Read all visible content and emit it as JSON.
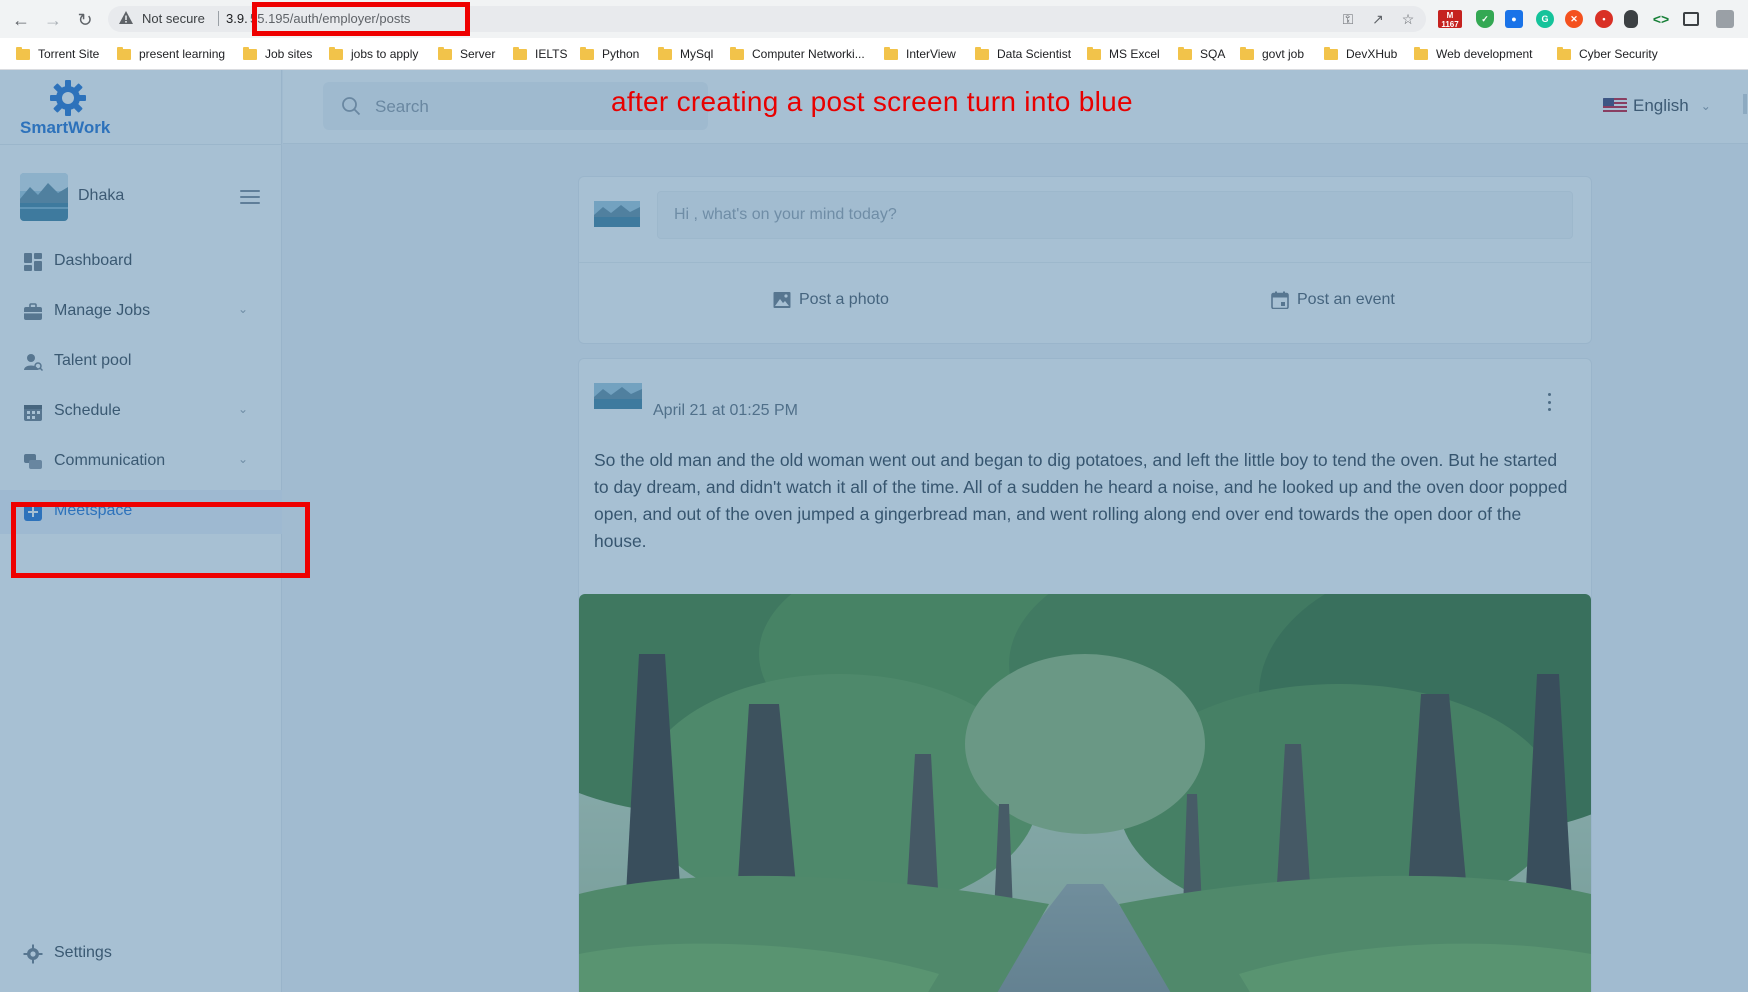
{
  "browser": {
    "security_label": "Not secure",
    "url_host": "3.9.",
    "url_path": "55.195/auth/employer/posts",
    "extensions": [
      {
        "name": "gmail-extension-icon",
        "badge": "1167",
        "color": "#c5221f"
      },
      {
        "name": "shield-extension-icon",
        "color": "#34a853"
      },
      {
        "name": "drop-extension-icon",
        "color": "#1a73e8"
      },
      {
        "name": "grammarly-extension-icon",
        "color": "#15c39a"
      },
      {
        "name": "orange-extension-icon",
        "color": "#f4511e"
      },
      {
        "name": "red-extension-icon",
        "color": "#d93025"
      },
      {
        "name": "mouse-extension-icon",
        "color": "#3c4043"
      },
      {
        "name": "code-extension-icon",
        "color": "#188038"
      },
      {
        "name": "screenshot-extension-icon",
        "color": "#3c4043"
      }
    ],
    "bookmarks": [
      "Torrent Site",
      "present learning",
      "Job sites",
      "jobs to apply",
      "Server",
      "IELTS",
      "Python",
      "MySql",
      "Computer Networki...",
      "InterView",
      "Data Scientist",
      "MS Excel",
      "SQA",
      "govt job",
      "DevXHub",
      "Web development",
      "Cyber Security"
    ]
  },
  "app": {
    "brand": "SmartWork",
    "profile_name": "Dhaka",
    "nav": [
      {
        "label": "Dashboard",
        "icon": "dashboard-icon",
        "chevron": false,
        "active": false
      },
      {
        "label": "Manage Jobs",
        "icon": "briefcase-icon",
        "chevron": true,
        "active": false
      },
      {
        "label": "Talent pool",
        "icon": "user-search-icon",
        "chevron": false,
        "active": false
      },
      {
        "label": "Schedule",
        "icon": "calendar-icon",
        "chevron": true,
        "active": false
      },
      {
        "label": "Communication",
        "icon": "chat-icon",
        "chevron": true,
        "active": false
      },
      {
        "label": "Meetspace",
        "icon": "plus-square-icon",
        "chevron": false,
        "active": true
      }
    ],
    "settings_label": "Settings",
    "search_placeholder": "Search",
    "language": "English",
    "composer": {
      "placeholder": "Hi , what's on your mind today?",
      "photo_label": "Post a photo",
      "event_label": "Post an event"
    },
    "post": {
      "time": "April 21 at 01:25 PM",
      "body": "So the old man and the old woman went out and began to dig potatoes, and left the little boy to tend the oven. But he started to day dream, and didn't watch it all of the time. All of a sudden he heard a noise, and he looked up and the oven door popped open, and out of the oven jumped a gingerbread man, and went rolling along end over end towards the open door of the house."
    }
  },
  "annotation": {
    "text": "after creating a post screen turn into blue",
    "color": "#ee0000"
  },
  "colors": {
    "accent": "#1e6fd2",
    "overlay": "#4076a0"
  }
}
